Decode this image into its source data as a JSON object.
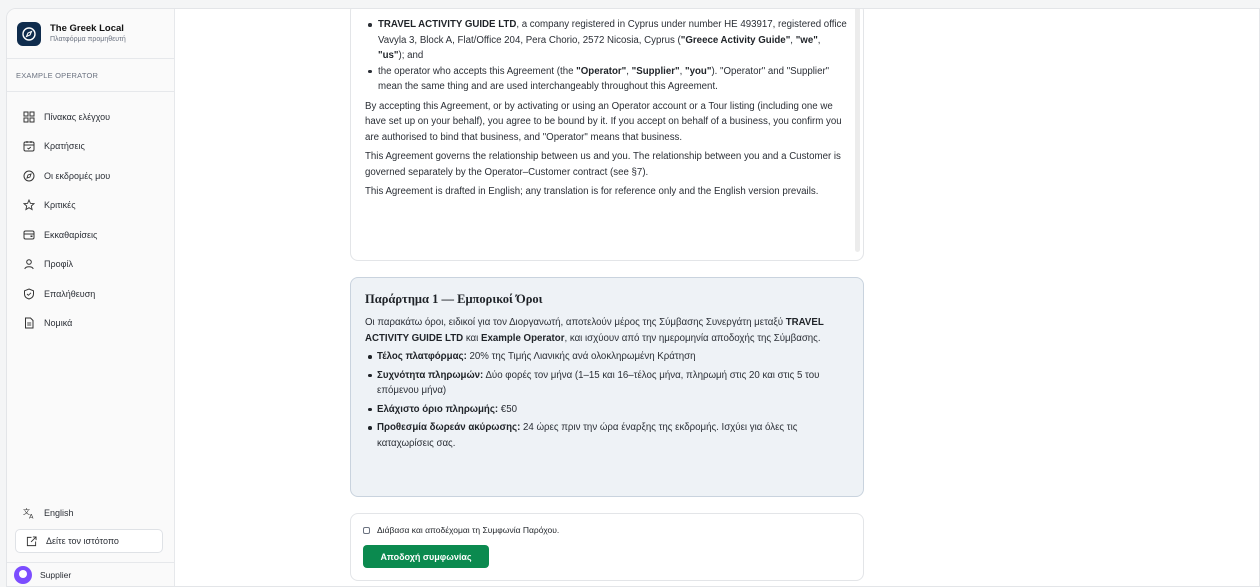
{
  "brand": {
    "name": "The Greek Local",
    "subtitle": "Πλατφόρμα προμηθευτή"
  },
  "sidebar": {
    "section_label": "EXAMPLE OPERATOR",
    "items": [
      {
        "label": "Πίνακας ελέγχου",
        "icon": "dashboard-icon"
      },
      {
        "label": "Κρατήσεις",
        "icon": "calendar-icon"
      },
      {
        "label": "Οι εκδρομές μου",
        "icon": "compass-icon"
      },
      {
        "label": "Κριτικές",
        "icon": "star-icon"
      },
      {
        "label": "Εκκαθαρίσεις",
        "icon": "wallet-icon"
      },
      {
        "label": "Προφίλ",
        "icon": "user-icon"
      },
      {
        "label": "Επαλήθευση",
        "icon": "shield-check-icon"
      },
      {
        "label": "Νομικά",
        "icon": "document-icon"
      }
    ],
    "language": "English",
    "view_site": "Δείτε τον ιστότοπο",
    "user": "Supplier"
  },
  "agreement": {
    "bullet1": {
      "company": "TRAVEL ACTIVITY GUIDE LTD",
      "text": ", a company registered in Cyprus under number HE 493917, registered office Vavyla 3, Block A, Flat/Office 204, Pera Chorio, 2572 Nicosia, Cyprus (",
      "q1": "\"Greece Activity Guide\"",
      "q2": "\"we\"",
      "q3": "\"us\"",
      "end": "); and"
    },
    "bullet2": {
      "text": "the operator who accepts this Agreement (the ",
      "q1": "\"Operator\"",
      "q2": "\"Supplier\"",
      "q3": "\"you\"",
      "end": "). \"Operator\" and \"Supplier\" mean the same thing and are used interchangeably throughout this Agreement."
    },
    "para1": "By accepting this Agreement, or by activating or using an Operator account or a Tour listing (including one we have set up on your behalf), you agree to be bound by it. If you accept on behalf of a business, you confirm you are authorised to bind that business, and \"Operator\" means that business.",
    "para2": "This Agreement governs the relationship between us and you. The relationship between you and a Customer is governed separately by the Operator–Customer contract (see §7).",
    "para3": "This Agreement is drafted in English; any translation is for reference only and the English version prevails."
  },
  "annex": {
    "title": "Παράρτημα 1 — Εμπορικοί Όροι",
    "intro_a": "Οι παρακάτω όροι, ειδικοί για τον Διοργανωτή, αποτελούν μέρος της Σύμβασης Συνεργάτη μεταξύ ",
    "intro_company": "TRAVEL ACTIVITY GUIDE LTD",
    "intro_b": " και ",
    "intro_operator": "Example Operator",
    "intro_c": ", και ισχύουν από την ημερομηνία αποδοχής της Σύμβασης.",
    "terms": [
      {
        "label": "Τέλος πλατφόρμας:",
        "value": " 20% της Τιμής Λιανικής ανά ολοκληρωμένη Κράτηση"
      },
      {
        "label": "Συχνότητα πληρωμών:",
        "value": " Δύο φορές τον μήνα (1–15 και 16–τέλος μήνα, πληρωμή στις 20 και στις 5 του επόμενου μήνα)"
      },
      {
        "label": "Ελάχιστο όριο πληρωμής:",
        "value": " €50"
      },
      {
        "label": "Προθεσμία δωρεάν ακύρωσης:",
        "value": " 24 ώρες πριν την ώρα έναρξης της εκδρομής. Ισχύει για όλες τις καταχωρίσεις σας."
      }
    ]
  },
  "accept": {
    "checkbox_label": "Διάβασα και αποδέχομαι τη Συμφωνία Παρόχου.",
    "button": "Αποδοχή συμφωνίας"
  },
  "colors": {
    "brand": "#0f2c4d",
    "accept": "#0b8a4f",
    "annex_bg": "#eef2f6",
    "avatar": "#7c4dff"
  }
}
